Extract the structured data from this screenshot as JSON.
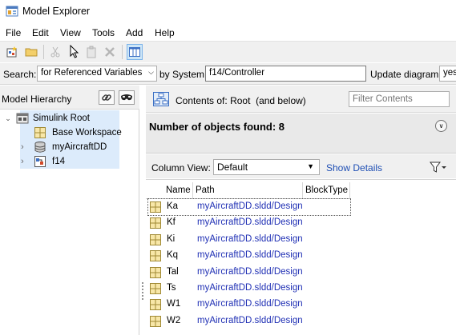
{
  "window": {
    "title": "Model Explorer"
  },
  "menu": {
    "items": [
      "File",
      "Edit",
      "View",
      "Tools",
      "Add",
      "Help"
    ]
  },
  "search": {
    "label": "Search:",
    "mode": "for Referenced Variables",
    "by_system_label": "by System:",
    "system_path": "f14/Controller",
    "update_diagram_label": "Update diagram:",
    "update_diagram_value": "yes"
  },
  "model_hierarchy": {
    "title": "Model Hierarchy",
    "tree": [
      {
        "label": "Simulink Root",
        "icon": "simulink-root-icon",
        "expanded": true
      },
      {
        "label": "Base Workspace",
        "icon": "workspace-grid-icon"
      },
      {
        "label": "myAircraftDD",
        "icon": "database-icon",
        "expandable": true
      },
      {
        "label": "f14",
        "icon": "model-icon",
        "expandable": true
      }
    ]
  },
  "contents": {
    "prefix": "Contents of:",
    "scope": "Root  (and below)",
    "filter_placeholder": "Filter Contents",
    "found_text": "Number of objects found: 8",
    "column_view_label": "Column View:",
    "column_view_value": "Default",
    "show_details_label": "Show Details",
    "columns": [
      "Name",
      "Path",
      "BlockType"
    ],
    "rows": [
      {
        "name": "Ka",
        "path": "myAircraftDD.sldd/Design"
      },
      {
        "name": "Kf",
        "path": "myAircraftDD.sldd/Design"
      },
      {
        "name": "Ki",
        "path": "myAircraftDD.sldd/Design"
      },
      {
        "name": "Kq",
        "path": "myAircraftDD.sldd/Design"
      },
      {
        "name": "Tal",
        "path": "myAircraftDD.sldd/Design"
      },
      {
        "name": "Ts",
        "path": "myAircraftDD.sldd/Design"
      },
      {
        "name": "W1",
        "path": "myAircraftDD.sldd/Design"
      },
      {
        "name": "W2",
        "path": "myAircraftDD.sldd/Design"
      }
    ]
  },
  "colors": {
    "link": "#1f2fb4",
    "selection": "#dcebfb",
    "toolbar_bg": "#f0f0f0"
  }
}
